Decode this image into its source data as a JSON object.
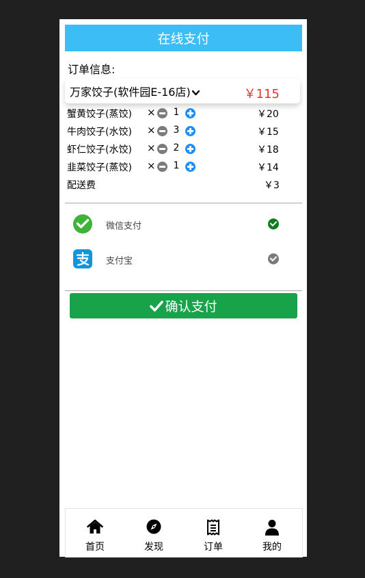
{
  "header": {
    "title": "在线支付"
  },
  "order": {
    "section_title": "订单信息:",
    "store_name": "万家饺子(软件园E-16店)",
    "total": "￥115",
    "items": [
      {
        "name": "蟹黄饺子(蒸饺)",
        "times": "×",
        "qty": "1",
        "price": "￥20"
      },
      {
        "name": "牛肉饺子(水饺)",
        "times": "×",
        "qty": "3",
        "price": "￥15"
      },
      {
        "name": "虾仁饺子(水饺)",
        "times": "×",
        "qty": "2",
        "price": "￥18"
      },
      {
        "name": "韭菜饺子(蒸饺)",
        "times": "×",
        "qty": "1",
        "price": "￥14"
      }
    ],
    "delivery_label": "配送费",
    "delivery_price": "￥3"
  },
  "payment": {
    "methods": [
      {
        "label": "微信支付",
        "icon": "wechat-pay-icon",
        "selected": true
      },
      {
        "label": "支付宝",
        "icon": "alipay-icon",
        "selected": false
      }
    ]
  },
  "confirm_label": "确认支付",
  "tabbar": {
    "tabs": [
      {
        "label": "首页",
        "icon": "home-icon"
      },
      {
        "label": "发现",
        "icon": "compass-icon"
      },
      {
        "label": "订单",
        "icon": "receipt-icon"
      },
      {
        "label": "我的",
        "icon": "user-icon"
      }
    ]
  },
  "colors": {
    "header_bg": "#3cbdf6",
    "total_price": "#e8312f",
    "confirm_bg": "#18a34a",
    "selected_check": "#0f7d1e",
    "unselected_check": "#7b7b7b",
    "plus_blue": "#1e8efc",
    "wechat_green": "#3fb23a",
    "alipay_blue": "#1296db"
  }
}
